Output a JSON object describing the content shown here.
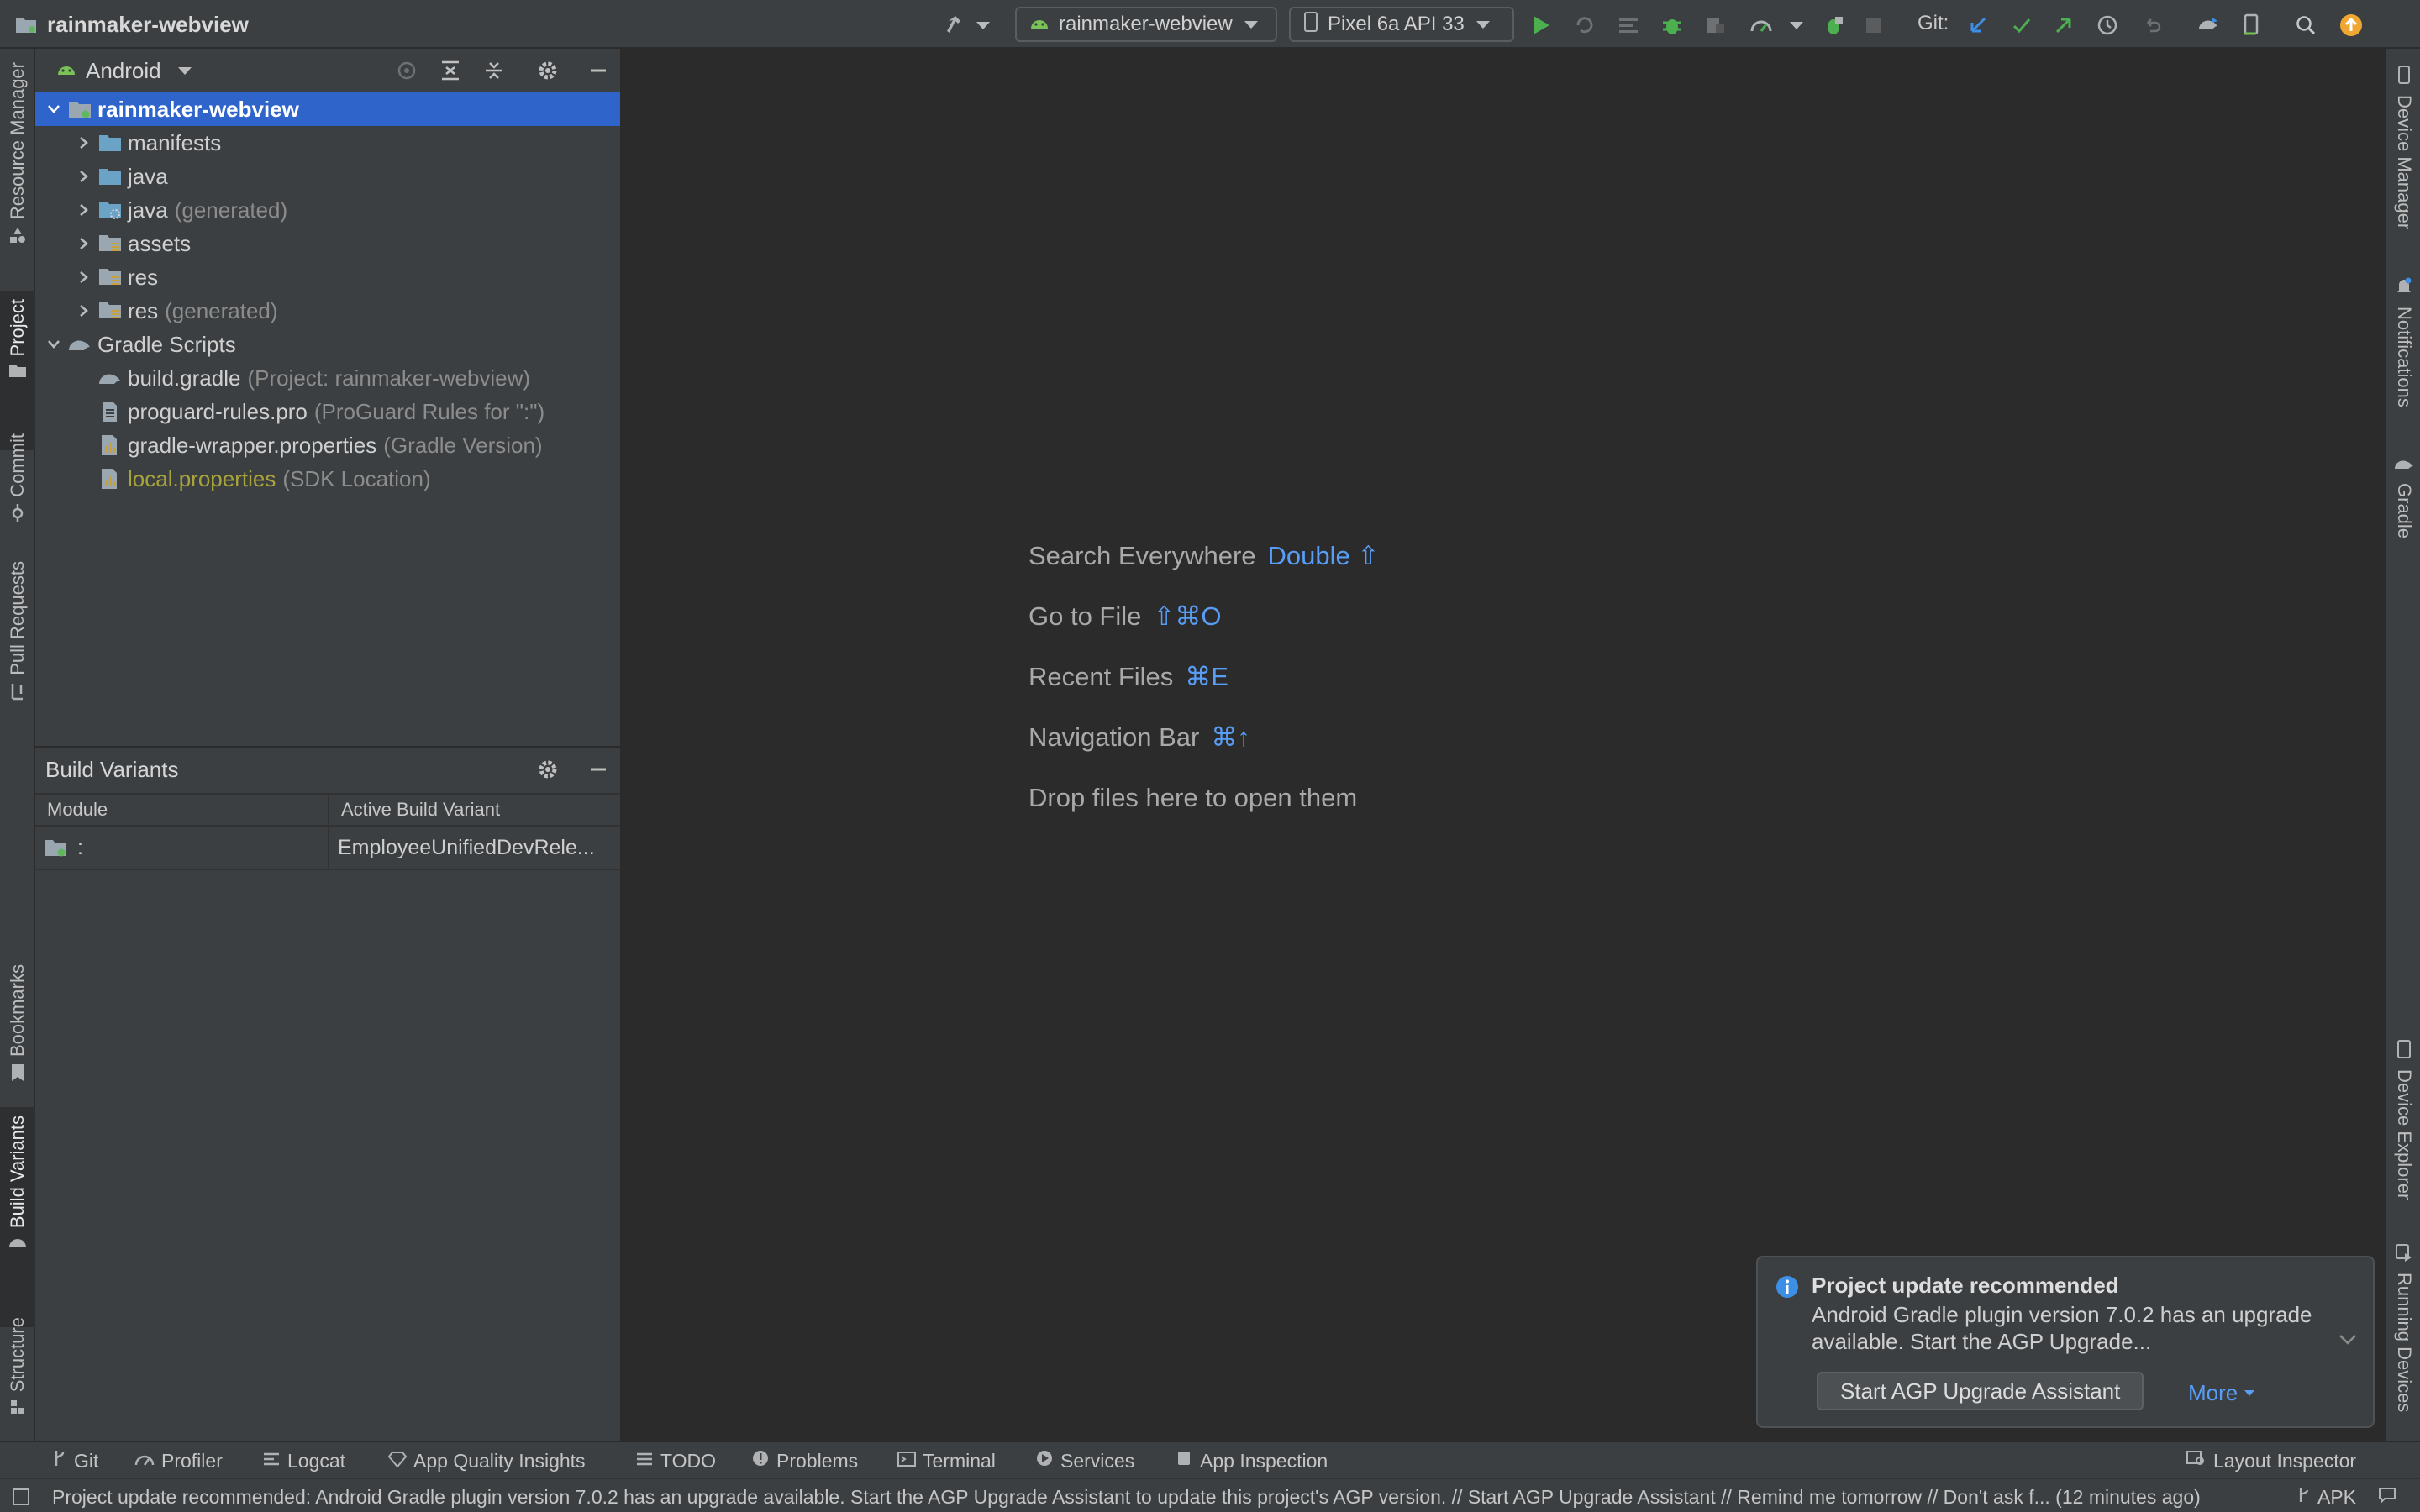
{
  "app": {
    "project_name": "rainmaker-webview"
  },
  "toolbar": {
    "run_config": "rainmaker-webview",
    "device": "Pixel 6a API 33",
    "git_label": "Git:",
    "icons": [
      "hammer-icon",
      "run-icon",
      "rerun-icon",
      "apply-changes-icon",
      "debug-icon",
      "attach-debugger-icon",
      "profile-icon",
      "attach-profiler-icon",
      "stop-icon",
      "git-update-icon",
      "git-commit-icon",
      "git-push-icon",
      "history-icon",
      "rollback-icon",
      "gradle-sync-icon",
      "device-manager-icon",
      "search-icon",
      "update-icon"
    ]
  },
  "left_strip": {
    "tabs": [
      {
        "label": "Resource Manager",
        "active": false
      },
      {
        "label": "Project",
        "active": true
      },
      {
        "label": "Commit",
        "active": false
      },
      {
        "label": "Pull Requests",
        "active": false
      },
      {
        "label": "Bookmarks",
        "active": false
      },
      {
        "label": "Build Variants",
        "active": true
      },
      {
        "label": "Structure",
        "active": false
      }
    ]
  },
  "right_strip": {
    "tabs": [
      {
        "label": "Device Manager"
      },
      {
        "label": "Notifications"
      },
      {
        "label": "Gradle"
      },
      {
        "label": "Device Explorer"
      },
      {
        "label": "Running Devices"
      }
    ]
  },
  "project_panel": {
    "view_mode": "Android",
    "tree": [
      {
        "label": "rainmaker-webview",
        "note": "",
        "selected": true,
        "expanded": true
      },
      {
        "label": "manifests",
        "note": ""
      },
      {
        "label": "java",
        "note": ""
      },
      {
        "label": "java",
        "note": "(generated)"
      },
      {
        "label": "assets",
        "note": ""
      },
      {
        "label": "res",
        "note": ""
      },
      {
        "label": "res",
        "note": "(generated)"
      },
      {
        "label": "Gradle Scripts",
        "note": "",
        "expanded": true
      },
      {
        "label": "build.gradle",
        "note": "(Project: rainmaker-webview)"
      },
      {
        "label": "proguard-rules.pro",
        "note": "(ProGuard Rules for \":\")"
      },
      {
        "label": "gradle-wrapper.properties",
        "note": "(Gradle Version)"
      },
      {
        "label": "local.properties",
        "note": "(SDK Location)"
      }
    ]
  },
  "build_variants": {
    "title": "Build Variants",
    "columns": {
      "module": "Module",
      "variant": "Active Build Variant"
    },
    "rows": [
      {
        "module": ":",
        "variant": "EmployeeUnifiedDevRele..."
      }
    ]
  },
  "editor": {
    "hints": [
      {
        "label": "Search Everywhere",
        "key": "Double ⇧"
      },
      {
        "label": "Go to File",
        "key": "⇧⌘O"
      },
      {
        "label": "Recent Files",
        "key": "⌘E"
      },
      {
        "label": "Navigation Bar",
        "key": "⌘↑"
      },
      {
        "label": "Drop files here to open them",
        "key": ""
      }
    ]
  },
  "notification": {
    "title": "Project update recommended",
    "body": "Android Gradle plugin version 7.0.2 has an upgrade available. Start the AGP Upgrade...",
    "button": "Start AGP Upgrade Assistant",
    "more": "More"
  },
  "bottom_bar": {
    "tabs": [
      "Git",
      "Profiler",
      "Logcat",
      "App Quality Insights",
      "TODO",
      "Problems",
      "Terminal",
      "Services",
      "App Inspection"
    ],
    "right_tab": "Layout Inspector"
  },
  "status_bar": {
    "message": "Project update recommended: Android Gradle plugin version 7.0.2 has an upgrade available.  Start the AGP Upgrade Assistant to update this project's AGP version. // Start AGP Upgrade Assistant // Remind me tomorrow // Don't ask f... (12 minutes ago)",
    "right_label": "APK"
  },
  "colors": {
    "accent": "#2f65ca",
    "link": "#589df6",
    "run_green": "#4caf50",
    "android_green": "#78c257"
  }
}
